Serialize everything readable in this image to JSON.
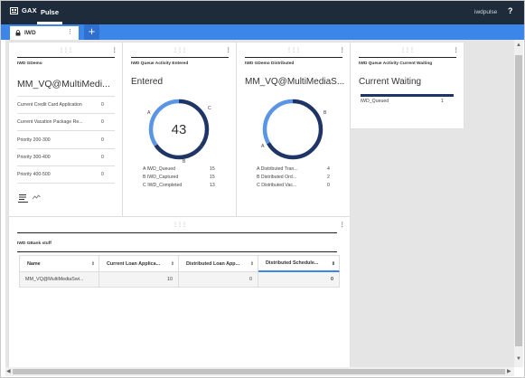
{
  "app": {
    "brand": "GAX",
    "nav_active": "Pulse",
    "user": "iwdpulse",
    "help": "?"
  },
  "tab": {
    "label": "IWD",
    "add_label": "+"
  },
  "colors": {
    "topbar": "#1e2b3a",
    "accent": "#3b86e8",
    "donut_dark": "#1f3566",
    "donut_light": "#5b95e5"
  },
  "cards": {
    "gdemo": {
      "title": "IWD GDemo",
      "value": "MM_VQ@MultiMedi...",
      "rows": [
        {
          "label": "Current Credit Card Application",
          "value": "0"
        },
        {
          "label": "Current Vacation Package Re...",
          "value": "0"
        },
        {
          "label": "Priority 200-300",
          "value": "0"
        },
        {
          "label": "Priority 300-400",
          "value": "0"
        },
        {
          "label": "Priority 400-500",
          "value": "0"
        }
      ]
    },
    "queue_entered": {
      "title": "IWD Queue Activity Entered",
      "heading": "Entered",
      "total": "43",
      "letters": [
        "A",
        "B",
        "C"
      ],
      "legend": [
        {
          "label": "A IWD_Queued",
          "value": "15"
        },
        {
          "label": "B IWD_Captured",
          "value": "15"
        },
        {
          "label": "C IWD_Completed",
          "value": "13"
        }
      ]
    },
    "gdemo_distributed": {
      "title": "IWD GDemo Distributed",
      "value": "MM_VQ@MultiMediaS...",
      "letters": [
        "A",
        "B"
      ],
      "legend": [
        {
          "label": "A Distributed Tran...",
          "value": "4"
        },
        {
          "label": "B Distributed Ord...",
          "value": "2"
        },
        {
          "label": "C Distributed Vac...",
          "value": "0"
        }
      ]
    },
    "current_waiting": {
      "title": "IWD Queue Activity Current Waiting",
      "heading": "Current Waiting",
      "rows": [
        {
          "label": "iWD_Queued",
          "value": "1"
        }
      ]
    },
    "gbank": {
      "title": "IWD GBank stuff",
      "columns": [
        "Name",
        "Current Loan Applica...",
        "Distributed Loan App...",
        "Distributed Schedule..."
      ],
      "rows": [
        [
          "MM_VQ@MultiMediaSwi...",
          "10",
          "0",
          "0"
        ]
      ]
    }
  },
  "icons": [
    "gax-logo-icon",
    "lock-icon",
    "kebab-menu-icon",
    "drag-handle-icon",
    "list-view-icon",
    "chart-view-icon",
    "sort-icon"
  ]
}
